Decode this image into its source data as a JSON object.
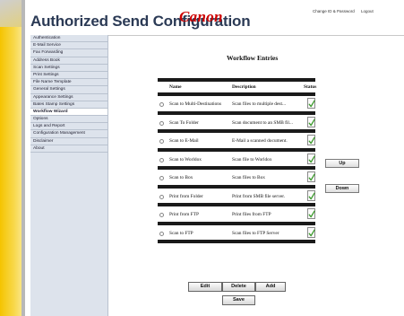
{
  "header": {
    "title": "Authorized Send Configuration",
    "brand": "Canon",
    "links": [
      "Change ID & Password",
      "Logout"
    ]
  },
  "sidebar": {
    "items": [
      {
        "label": "Authentication",
        "active": false
      },
      {
        "label": "E-Mail Service",
        "active": false
      },
      {
        "label": "Fax Forwarding",
        "active": false
      },
      {
        "label": "Address Book",
        "active": false
      },
      {
        "label": "Scan Settings",
        "active": false
      },
      {
        "label": "Print Settings",
        "active": false
      },
      {
        "label": "File Name Template",
        "active": false
      },
      {
        "label": "General Settings",
        "active": false
      },
      {
        "label": "Appearance Settings",
        "active": false
      },
      {
        "label": "Bates Stamp Settings",
        "active": false
      },
      {
        "label": "Workflow Wizard",
        "active": true
      },
      {
        "label": "Options",
        "active": false
      },
      {
        "label": "Logs and Report",
        "active": false
      },
      {
        "label": "Configuration Management",
        "active": false
      },
      {
        "label": "Disclaimer",
        "active": false
      },
      {
        "label": "About",
        "active": false
      }
    ]
  },
  "main": {
    "title": "Workflow Entries",
    "columns": {
      "name": "Name",
      "description": "Description",
      "status": "Status"
    },
    "rows": [
      {
        "name": "Scan to Multi-Destinations",
        "description": "Scan files to multiple dest...",
        "status": "enabled"
      },
      {
        "name": "Scan To Folder",
        "description": "Scan document to an SMB fil...",
        "status": "enabled"
      },
      {
        "name": "Scan to E-Mail",
        "description": "E-Mail a scanned document.",
        "status": "enabled"
      },
      {
        "name": "Scan to Worldox",
        "description": "Scan file to Worldox",
        "status": "enabled"
      },
      {
        "name": "Scan to Box",
        "description": "Scan files to Box",
        "status": "enabled"
      },
      {
        "name": "Print from Folder",
        "description": "Print from SMB file server.",
        "status": "enabled"
      },
      {
        "name": "Print from FTP",
        "description": "Print files from FTP",
        "status": "enabled"
      },
      {
        "name": "Scan to FTP",
        "description": "Scan files to FTP Server",
        "status": "enabled"
      }
    ],
    "buttons": {
      "up": "Up",
      "down": "Down",
      "edit": "Edit",
      "delete": "Delete",
      "add": "Add",
      "save": "Save"
    }
  },
  "colors": {
    "brand": "#cc0000",
    "title": "#2b3a55",
    "sidebar_bg": "#dde3ec",
    "accent_yellow": "#f5c400"
  },
  "icons": {
    "status": "checkmark-document-icon"
  }
}
